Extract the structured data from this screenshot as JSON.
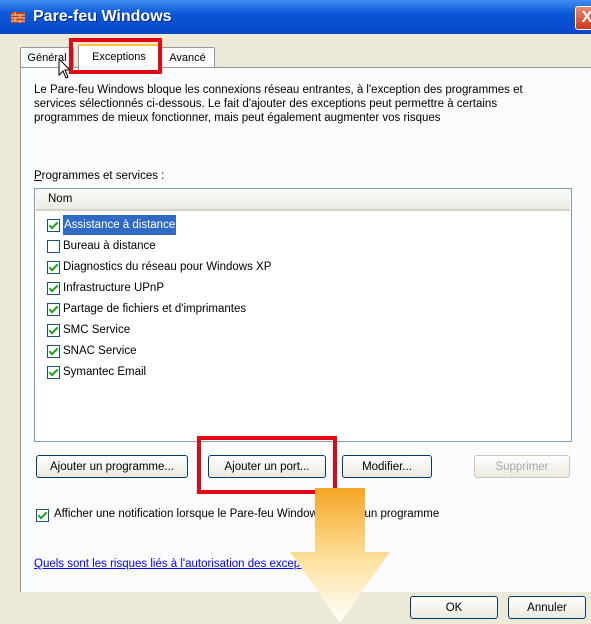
{
  "window": {
    "title": "Pare-feu Windows",
    "close_glyph": "X"
  },
  "tabs": [
    {
      "label": "Général",
      "active": false
    },
    {
      "label": "Exceptions",
      "active": true
    },
    {
      "label": "Avancé",
      "active": false
    }
  ],
  "description": "Le Pare-feu Windows bloque les connexions réseau entrantes, à l'exception des programmes et services sélectionnés ci-dessous. Le fait d'ajouter des exceptions peut permettre à certains programmes de mieux fonctionner, mais peut également augmenter vos risques",
  "programs": {
    "label_u": "P",
    "label_rest": "rogrammes et services :",
    "column_header": "Nom",
    "items": [
      {
        "label": "Assistance à distance",
        "checked": true,
        "selected": true
      },
      {
        "label": "Bureau à distance",
        "checked": false,
        "selected": false
      },
      {
        "label": "Diagnostics du réseau pour Windows XP",
        "checked": true,
        "selected": false
      },
      {
        "label": "Infrastructure UPnP",
        "checked": true,
        "selected": false
      },
      {
        "label": "Partage de fichiers et d'imprimantes",
        "checked": true,
        "selected": false
      },
      {
        "label": "SMC Service",
        "checked": true,
        "selected": false
      },
      {
        "label": "SNAC Service",
        "checked": true,
        "selected": false
      },
      {
        "label": "Symantec Email",
        "checked": true,
        "selected": false
      }
    ]
  },
  "buttons": {
    "add_program": "Ajouter un programme...",
    "add_port": "Ajouter un port...",
    "modify": "Modifier...",
    "delete": "Supprimer",
    "ok": "OK",
    "cancel": "Annuler"
  },
  "notification": {
    "checked": true,
    "text": "Afficher une notification lorsque le Pare-feu Windows bloque un programme"
  },
  "risk_link": "Quels sont les risques liés à l'autorisation des exceptions ?",
  "colors": {
    "highlight": "#e30613",
    "arrow": "#f5a623",
    "selection": "#316ac5",
    "titlebar": "#0a58d8"
  }
}
